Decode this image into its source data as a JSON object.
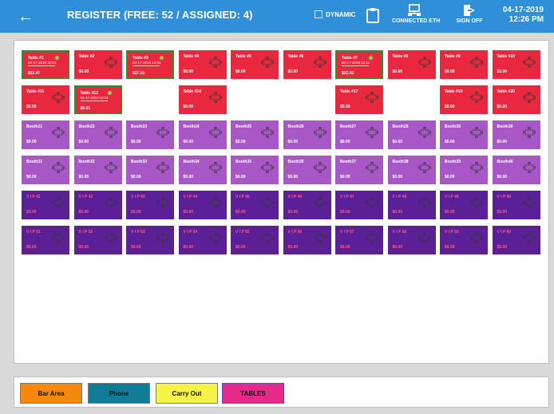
{
  "header": {
    "back_label": "←",
    "title": "REGISTER (FREE: 52 / ASSIGNED: 4)",
    "dynamic_label": "DYNAMIC",
    "connected_label": "CONNECTED ETH",
    "signoff_label": "SIGN OFF",
    "date": "04-17-2019",
    "time": "12:26 PM"
  },
  "colors": {
    "header": "#2f8fd8",
    "table_tile": "#e8283f",
    "booth_tile": "#a858c6",
    "vip_tile": "#5b1f96",
    "occupied_border": "#2f8d2e"
  },
  "tiles": [
    {
      "name": "Table #1",
      "amount": "$22.47",
      "kind": "red",
      "occupied": true,
      "time": "04-17-2019 12:01"
    },
    {
      "name": "Table #2",
      "amount": "$0.00",
      "kind": "red"
    },
    {
      "name": "Table #3",
      "amount": "$17.01",
      "kind": "red",
      "occupied": true,
      "time": "04-17-2019 12:01"
    },
    {
      "name": "Table #4",
      "amount": "$0.00",
      "kind": "red"
    },
    {
      "name": "Table #5",
      "amount": "$0.00",
      "kind": "red"
    },
    {
      "name": "Table #6",
      "amount": "$0.00",
      "kind": "red"
    },
    {
      "name": "Table #7",
      "amount": "$22.42",
      "kind": "red",
      "occupied": true,
      "time": "04-17-2019 12:11"
    },
    {
      "name": "Table #8",
      "amount": "$0.00",
      "kind": "red"
    },
    {
      "name": "Table #9",
      "amount": "$0.00",
      "kind": "red"
    },
    {
      "name": "Table #10",
      "amount": "$0.00",
      "kind": "red"
    },
    {
      "name": "Table #11",
      "amount": "$0.00",
      "kind": "red"
    },
    {
      "name": "Table #12",
      "amount": "$6.01",
      "kind": "red",
      "occupied": true,
      "time": "04-17-2019 12:01"
    },
    {
      "kind": "empty"
    },
    {
      "name": "Table #14",
      "amount": "$0.00",
      "kind": "red"
    },
    {
      "kind": "empty"
    },
    {
      "kind": "empty"
    },
    {
      "name": "Table #17",
      "amount": "$0.00",
      "kind": "red"
    },
    {
      "kind": "empty"
    },
    {
      "name": "Table #19",
      "amount": "$0.00",
      "kind": "red"
    },
    {
      "name": "Table #20",
      "amount": "$0.00",
      "kind": "red"
    },
    {
      "name": "Booth21",
      "amount": "$0.00",
      "kind": "booth"
    },
    {
      "name": "Booth22",
      "amount": "$0.00",
      "kind": "booth"
    },
    {
      "name": "Booth23",
      "amount": "$0.00",
      "kind": "booth"
    },
    {
      "name": "Booth24",
      "amount": "$0.00",
      "kind": "booth"
    },
    {
      "name": "Booth25",
      "amount": "$0.00",
      "kind": "booth"
    },
    {
      "name": "Booth26",
      "amount": "$0.00",
      "kind": "booth"
    },
    {
      "name": "Booth27",
      "amount": "$0.00",
      "kind": "booth"
    },
    {
      "name": "Booth28",
      "amount": "$0.00",
      "kind": "booth"
    },
    {
      "name": "Booth29",
      "amount": "$0.00",
      "kind": "booth"
    },
    {
      "name": "Booth30",
      "amount": "$0.00",
      "kind": "booth"
    },
    {
      "name": "Booth31",
      "amount": "$0.00",
      "kind": "booth"
    },
    {
      "name": "Booth32",
      "amount": "$0.00",
      "kind": "booth"
    },
    {
      "name": "Booth33",
      "amount": "$0.00",
      "kind": "booth"
    },
    {
      "name": "Booth34",
      "amount": "$0.00",
      "kind": "booth"
    },
    {
      "name": "Booth35",
      "amount": "$0.00",
      "kind": "booth"
    },
    {
      "name": "Booth36",
      "amount": "$0.00",
      "kind": "booth"
    },
    {
      "name": "Booth37",
      "amount": "$0.00",
      "kind": "booth"
    },
    {
      "name": "Booth38",
      "amount": "$0.00",
      "kind": "booth"
    },
    {
      "name": "Booth39",
      "amount": "$0.00",
      "kind": "booth"
    },
    {
      "name": "Booth40",
      "amount": "$0.00",
      "kind": "booth"
    },
    {
      "name": "V I P 41",
      "amount": "$0.00",
      "kind": "vip"
    },
    {
      "name": "V I P 42",
      "amount": "$0.00",
      "kind": "vip"
    },
    {
      "name": "V I P 43",
      "amount": "$0.00",
      "kind": "vip"
    },
    {
      "name": "V I P 44",
      "amount": "$0.00",
      "kind": "vip"
    },
    {
      "name": "V I P 45",
      "amount": "$0.00",
      "kind": "vip"
    },
    {
      "name": "V I P 46",
      "amount": "$0.00",
      "kind": "vip"
    },
    {
      "name": "V I P 47",
      "amount": "$0.00",
      "kind": "vip"
    },
    {
      "name": "V I P 48",
      "amount": "$0.00",
      "kind": "vip"
    },
    {
      "name": "V I P 49",
      "amount": "$0.00",
      "kind": "vip"
    },
    {
      "name": "V I P 50",
      "amount": "$0.00",
      "kind": "vip"
    },
    {
      "name": "V I P 51",
      "amount": "$0.00",
      "kind": "vip"
    },
    {
      "name": "V I P 52",
      "amount": "$0.00",
      "kind": "vip"
    },
    {
      "name": "V I P 53",
      "amount": "$0.00",
      "kind": "vip"
    },
    {
      "name": "V I P 54",
      "amount": "$0.00",
      "kind": "vip"
    },
    {
      "name": "V I P 55",
      "amount": "$0.00",
      "kind": "vip"
    },
    {
      "name": "V I P 56",
      "amount": "$0.00",
      "kind": "vip"
    },
    {
      "name": "V I P 57",
      "amount": "$0.00",
      "kind": "vip"
    },
    {
      "name": "V I P 58",
      "amount": "$0.00",
      "kind": "vip"
    },
    {
      "name": "V I P 59",
      "amount": "$0.00",
      "kind": "vip"
    },
    {
      "name": "V I P 60",
      "amount": "$0.00",
      "kind": "vip"
    }
  ],
  "categories": [
    {
      "label": "Bar Area",
      "color": "#f5890f"
    },
    {
      "label": "Phone",
      "color": "#127b97"
    },
    {
      "label": "Carry Out",
      "color": "#f7f247"
    },
    {
      "label": "TABLES",
      "color": "#e42b8a"
    }
  ]
}
